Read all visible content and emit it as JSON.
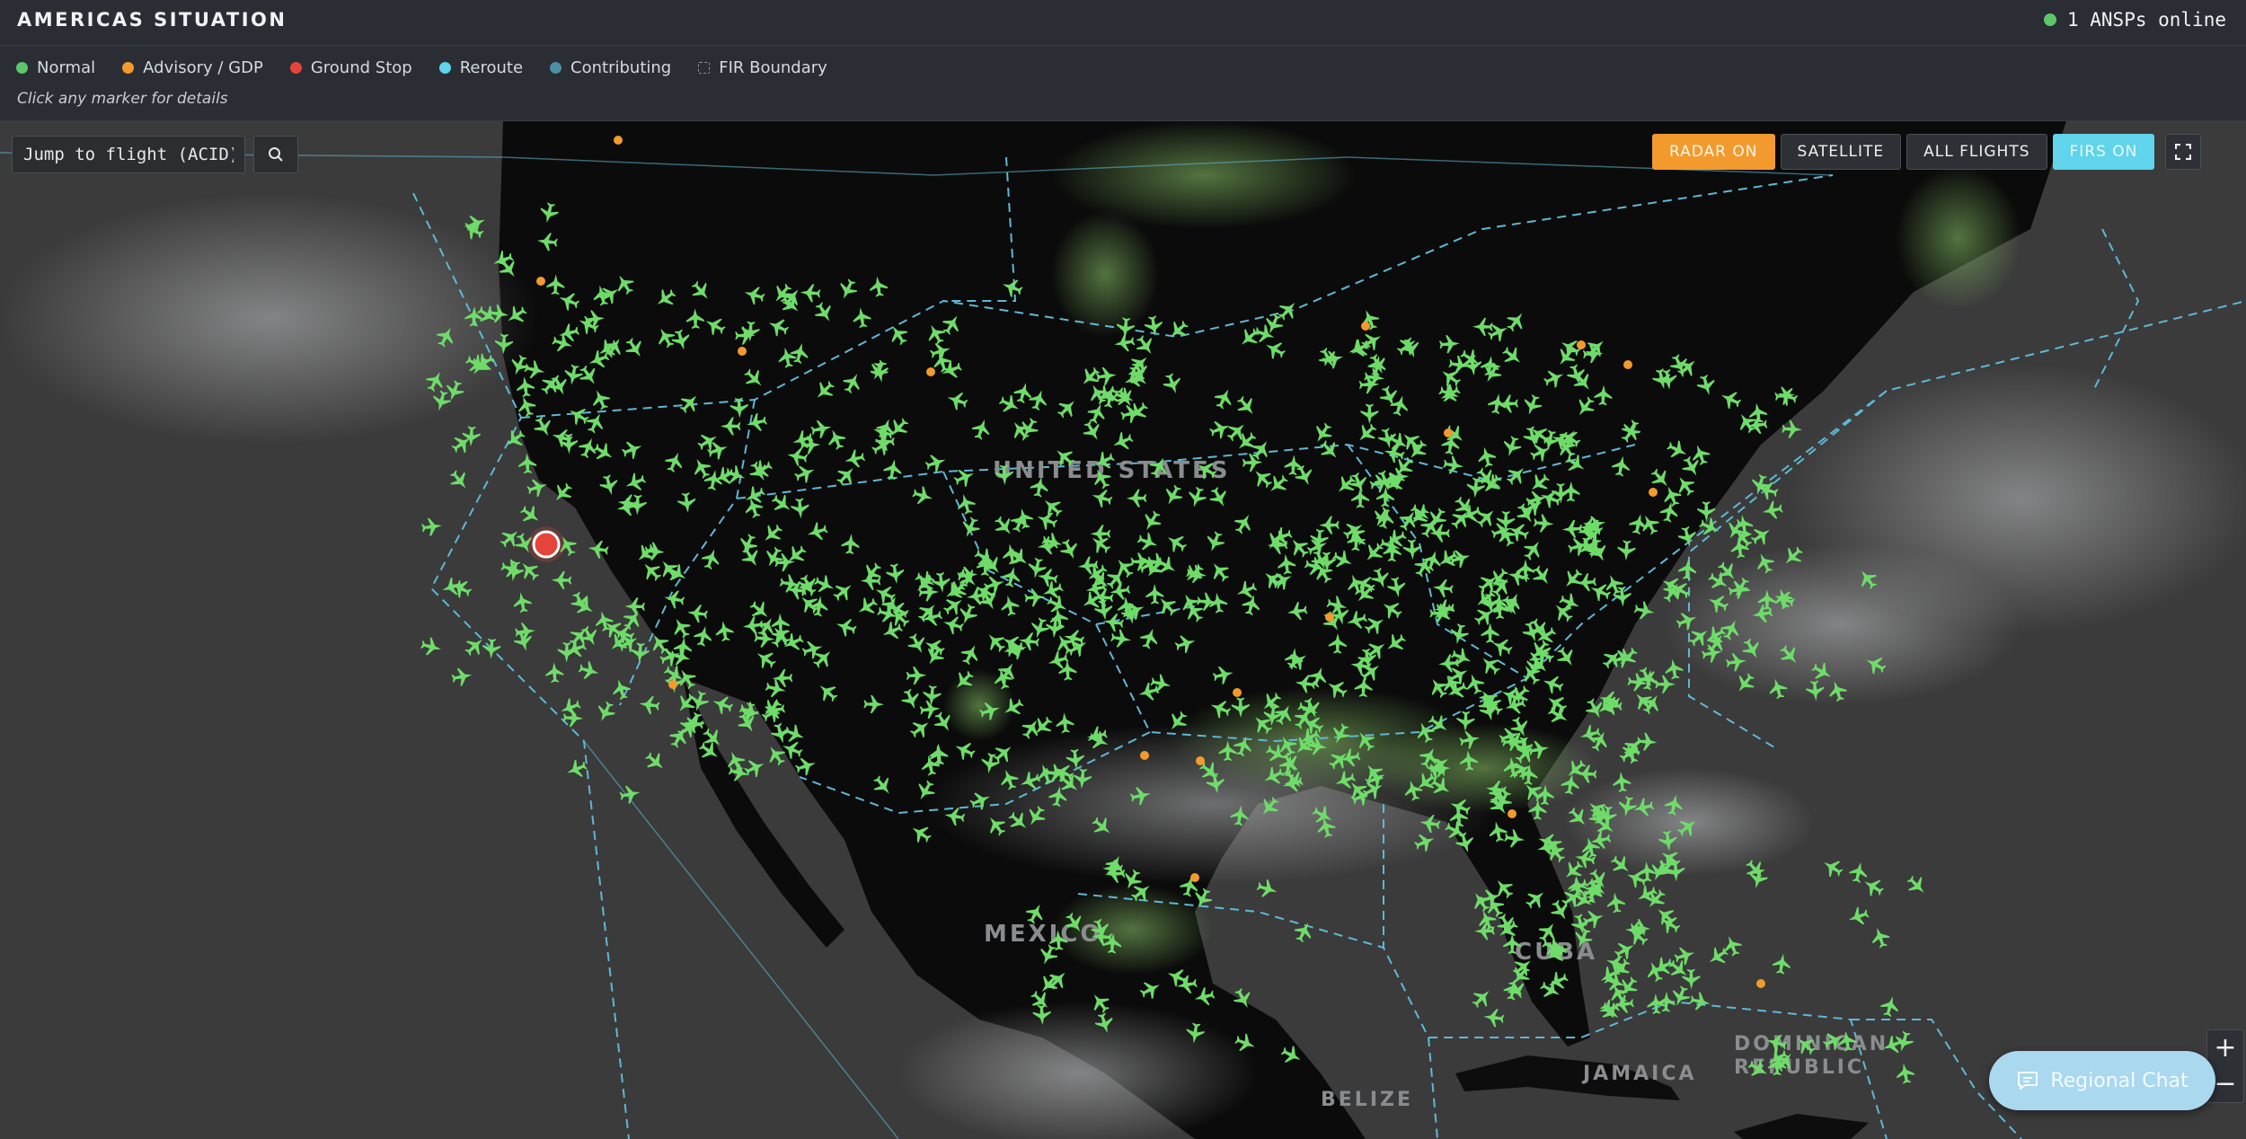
{
  "header": {
    "title": "AMERICAS SITUATION",
    "status_text": "1 ANSPs online",
    "status_color": "#5cc76a"
  },
  "legend": {
    "items": [
      {
        "label": "Normal",
        "color": "#5cc76a",
        "icon": "status-dot"
      },
      {
        "label": "Advisory / GDP",
        "color": "#f29a2e",
        "icon": "status-dot"
      },
      {
        "label": "Ground Stop",
        "color": "#e5443b",
        "icon": "status-dot"
      },
      {
        "label": "Reroute",
        "color": "#5fd4ea",
        "icon": "status-dot"
      },
      {
        "label": "Contributing",
        "color": "#4a8fa3",
        "icon": "status-dot"
      },
      {
        "label": "FIR Boundary",
        "color": "#8a9099",
        "icon": "dashed-square"
      }
    ],
    "hint": "Click any marker for details"
  },
  "search": {
    "placeholder": "Jump to flight (ACID)",
    "icon": "search-icon"
  },
  "toolbar": {
    "radar_label": "RADAR ON",
    "satellite_label": "SATELLITE",
    "flights_label": "ALL FLIGHTS",
    "firs_label": "FIRS ON",
    "fullscreen_icon": "fullscreen-icon"
  },
  "map": {
    "labels": [
      "UNITED STATES",
      "MEXICO",
      "CUBA",
      "DOMINICAN REPUBLIC",
      "JAMAICA",
      "BELIZE"
    ],
    "aircraft_color": "#6fdc6a",
    "fir_color": "#5fb8d6",
    "ground_stop_color": "#e5443b",
    "advisory_color": "#f29a2e"
  },
  "zoom": {
    "in_label": "+",
    "out_label": "−"
  },
  "chat": {
    "label": "Regional Chat",
    "icon": "chat-icon"
  }
}
